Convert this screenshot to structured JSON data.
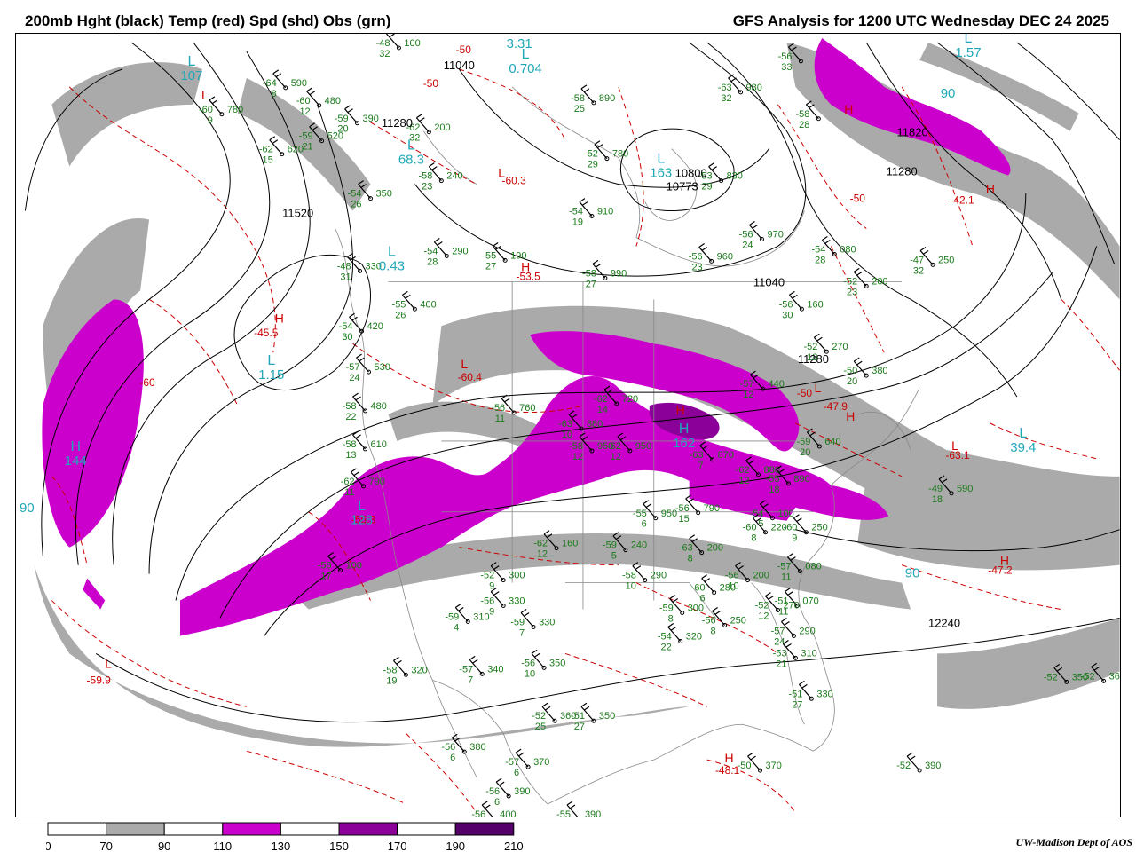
{
  "header": {
    "title_left": "200mb Hght (black) Temp (red) Spd (shd) Obs (grn)",
    "title_right": "GFS Analysis for 1200 UTC Wednesday  DEC 24 2025"
  },
  "colors": {
    "height_contour": "#000000",
    "temperature_contour": "#cc0000",
    "speed_70_90": "#aaaaaa",
    "speed_110_130": "#cc00cc",
    "speed_150_170": "#8a0099",
    "speed_190_210": "#55006a",
    "obs": "#1a7a1a",
    "height_center_label": "#20a8b8",
    "geography": "#888888"
  },
  "legend": {
    "ticks": [
      "0",
      "70",
      "90",
      "110",
      "130",
      "150",
      "170",
      "190",
      "210"
    ],
    "fills": [
      "#ffffff",
      "#aaaaaa",
      "#ffffff",
      "#cc00cc",
      "#ffffff",
      "#8a0099",
      "#ffffff",
      "#55006a"
    ]
  },
  "height_labels": [
    "11040",
    "11280",
    "11520",
    "10800",
    "10773",
    "11040",
    "11280",
    "11820",
    "11280",
    "12240"
  ],
  "temperature_labels": [
    "-50",
    "-50",
    "-50",
    "-60.3",
    "-53.5",
    "-45.5",
    "-60",
    "-60.4",
    "-55.3",
    "-59.9",
    "-50",
    "-47.9",
    "-63.1",
    "-42.1",
    "-47.2",
    "-48.1"
  ],
  "pressure_centers": [
    {
      "letter": "L",
      "value": "3.31"
    },
    {
      "letter": "L",
      "value": "0.704"
    },
    {
      "letter": "L",
      "value": "107"
    },
    {
      "letter": "L",
      "value": "68.3"
    },
    {
      "letter": "L",
      "value": "163"
    },
    {
      "letter": "L",
      "value": "0.43"
    },
    {
      "letter": "L",
      "value": "1.15"
    },
    {
      "letter": "H",
      "value": "144"
    },
    {
      "letter": "L",
      "value": "1.57"
    },
    {
      "letter": "L",
      "value": "39.4"
    },
    {
      "letter": "H",
      "value": "162"
    },
    {
      "letter": "L",
      "value": "128"
    }
  ],
  "isotach_labels": [
    "90",
    "90",
    "90"
  ],
  "extreme_markers": [
    "L",
    "L",
    "L",
    "H",
    "H",
    "L",
    "H",
    "L",
    "H",
    "H",
    "H",
    "L",
    "H",
    "H"
  ],
  "observations": [
    {
      "temp": "-48",
      "dew": "32",
      "hgt": "100"
    },
    {
      "temp": "-64",
      "dew": "8",
      "hgt": "590"
    },
    {
      "temp": "-60",
      "dew": "12",
      "hgt": "480"
    },
    {
      "temp": "-59",
      "dew": "20",
      "hgt": "390"
    },
    {
      "temp": "-59",
      "dew": "21",
      "hgt": "520"
    },
    {
      "temp": "-62",
      "dew": "15",
      "hgt": "620"
    },
    {
      "temp": "-60",
      "dew": "9",
      "hgt": "780"
    },
    {
      "temp": "-54",
      "dew": "26",
      "hgt": "350"
    },
    {
      "temp": "-48",
      "dew": "31",
      "hgt": "330"
    },
    {
      "temp": "-58",
      "dew": "23",
      "hgt": "240"
    },
    {
      "temp": "-55",
      "dew": "27",
      "hgt": "190"
    },
    {
      "temp": "-54",
      "dew": "28",
      "hgt": "290"
    },
    {
      "temp": "-62",
      "dew": "32",
      "hgt": "200"
    },
    {
      "temp": "-52",
      "dew": "29",
      "hgt": "780"
    },
    {
      "temp": "-58",
      "dew": "25",
      "hgt": "890"
    },
    {
      "temp": "-63",
      "dew": "32",
      "hgt": "980"
    },
    {
      "temp": "-54",
      "dew": "19",
      "hgt": "910"
    },
    {
      "temp": "-53",
      "dew": "29",
      "hgt": "830"
    },
    {
      "temp": "-56",
      "dew": "24",
      "hgt": "970"
    },
    {
      "temp": "-56",
      "dew": "23",
      "hgt": "960"
    },
    {
      "temp": "-58",
      "dew": "27",
      "hgt": "990"
    },
    {
      "temp": "-54",
      "dew": "28",
      "hgt": "080"
    },
    {
      "temp": "-47",
      "dew": "32",
      "hgt": "250"
    },
    {
      "temp": "-52",
      "dew": "23",
      "hgt": "200"
    },
    {
      "temp": "-56",
      "dew": "30",
      "hgt": "160"
    },
    {
      "temp": "-55",
      "dew": "26",
      "hgt": "400"
    },
    {
      "temp": "-54",
      "dew": "30",
      "hgt": "420"
    },
    {
      "temp": "-57",
      "dew": "24",
      "hgt": "530"
    },
    {
      "temp": "-58",
      "dew": "22",
      "hgt": "480"
    },
    {
      "temp": "-58",
      "dew": "13",
      "hgt": "610"
    },
    {
      "temp": "-62",
      "dew": "11",
      "hgt": "790"
    },
    {
      "temp": "-56",
      "dew": "11",
      "hgt": "760"
    },
    {
      "temp": "-62",
      "dew": "14",
      "hgt": "720"
    },
    {
      "temp": "-63",
      "dew": "10",
      "hgt": "880"
    },
    {
      "temp": "-58",
      "dew": "12",
      "hgt": "950"
    },
    {
      "temp": "-62",
      "dew": "12",
      "hgt": "950"
    },
    {
      "temp": "-52",
      "dew": "18",
      "hgt": "270"
    },
    {
      "temp": "-50",
      "dew": "20",
      "hgt": "380"
    },
    {
      "temp": "-57",
      "dew": "12",
      "hgt": "440"
    },
    {
      "temp": "-59",
      "dew": "20",
      "hgt": "640"
    },
    {
      "temp": "-63",
      "dew": "7",
      "hgt": "870"
    },
    {
      "temp": "-62",
      "dew": "12",
      "hgt": "880"
    },
    {
      "temp": "-55",
      "dew": "18",
      "hgt": "890"
    },
    {
      "temp": "-56",
      "dew": "15",
      "hgt": "790"
    },
    {
      "temp": "-55",
      "dew": "6",
      "hgt": "950"
    },
    {
      "temp": "-54",
      "dew": "5",
      "hgt": "100"
    },
    {
      "temp": "-60",
      "dew": "8",
      "hgt": "220"
    },
    {
      "temp": "-60",
      "dew": "9",
      "hgt": "250"
    },
    {
      "temp": "-62",
      "dew": "12",
      "hgt": "160"
    },
    {
      "temp": "-59",
      "dew": "5",
      "hgt": "240"
    },
    {
      "temp": "-63",
      "dew": "8",
      "hgt": "200"
    },
    {
      "temp": "-56",
      "dew": "17",
      "hgt": "100"
    },
    {
      "temp": "-57",
      "dew": "11",
      "hgt": "080"
    },
    {
      "temp": "-51",
      "dew": "11",
      "hgt": "070"
    },
    {
      "temp": "-56",
      "dew": "10",
      "hgt": "200"
    },
    {
      "temp": "-52",
      "dew": "9",
      "hgt": "300"
    },
    {
      "temp": "-58",
      "dew": "10",
      "hgt": "290"
    },
    {
      "temp": "-60",
      "dew": "6",
      "hgt": "280"
    },
    {
      "temp": "-56",
      "dew": "8",
      "hgt": "250"
    },
    {
      "temp": "-52",
      "dew": "12",
      "hgt": "270"
    },
    {
      "temp": "-56",
      "dew": "9",
      "hgt": "330"
    },
    {
      "temp": "-59",
      "dew": "8",
      "hgt": "300"
    },
    {
      "temp": "-59",
      "dew": "4",
      "hgt": "310"
    },
    {
      "temp": "-59",
      "dew": "7",
      "hgt": "330"
    },
    {
      "temp": "-54",
      "dew": "22",
      "hgt": "320"
    },
    {
      "temp": "-57",
      "dew": "24",
      "hgt": "290"
    },
    {
      "temp": "-53",
      "dew": "21",
      "hgt": "310"
    },
    {
      "temp": "-58",
      "dew": "19",
      "hgt": "320"
    },
    {
      "temp": "-57",
      "dew": "7",
      "hgt": "340"
    },
    {
      "temp": "-56",
      "dew": "10",
      "hgt": "350"
    },
    {
      "temp": "-51",
      "dew": "27",
      "hgt": "330"
    },
    {
      "temp": "-52",
      "dew": "25",
      "hgt": "360"
    },
    {
      "temp": "-51",
      "dew": "27",
      "hgt": "350"
    },
    {
      "temp": "-56",
      "dew": "6",
      "hgt": "380"
    },
    {
      "temp": "-57",
      "dew": "6",
      "hgt": "370"
    },
    {
      "temp": "-56",
      "dew": "6",
      "hgt": "390"
    },
    {
      "temp": "-56",
      "dew": "13",
      "hgt": "400"
    },
    {
      "temp": "-55",
      "dew": "",
      "hgt": "390"
    },
    {
      "temp": "-50",
      "dew": "",
      "hgt": "370"
    },
    {
      "temp": "-52",
      "dew": "",
      "hgt": "390"
    },
    {
      "temp": "-52",
      "dew": "",
      "hgt": "360"
    },
    {
      "temp": "-52",
      "dew": "",
      "hgt": "350"
    },
    {
      "temp": "-56",
      "dew": "33",
      "hgt": ""
    },
    {
      "temp": "-58",
      "dew": "28",
      "hgt": ""
    },
    {
      "temp": "-49",
      "dew": "18",
      "hgt": "590"
    }
  ],
  "credit": "UW-Madison  Dept of AOS"
}
